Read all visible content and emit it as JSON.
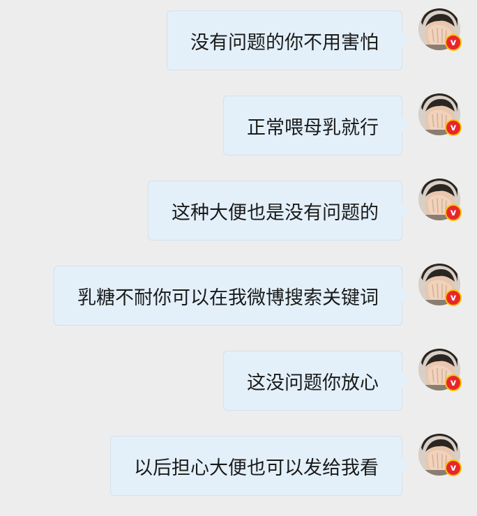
{
  "messages": [
    {
      "text": "没有问题的你不用害怕",
      "badge": "v"
    },
    {
      "text": "正常喂母乳就行",
      "badge": "v"
    },
    {
      "text": "这种大便也是没有问题的",
      "badge": "v"
    },
    {
      "text": "乳糖不耐你可以在我微博搜索关键词",
      "badge": "v"
    },
    {
      "text": "这没问题你放心",
      "badge": "v"
    },
    {
      "text": "以后担心大便也可以发给我看",
      "badge": "v"
    }
  ],
  "colors": {
    "background": "#ededed",
    "bubble": "#e3f0fa",
    "badge_red": "#e8262a",
    "badge_gold": "#f7c400"
  }
}
